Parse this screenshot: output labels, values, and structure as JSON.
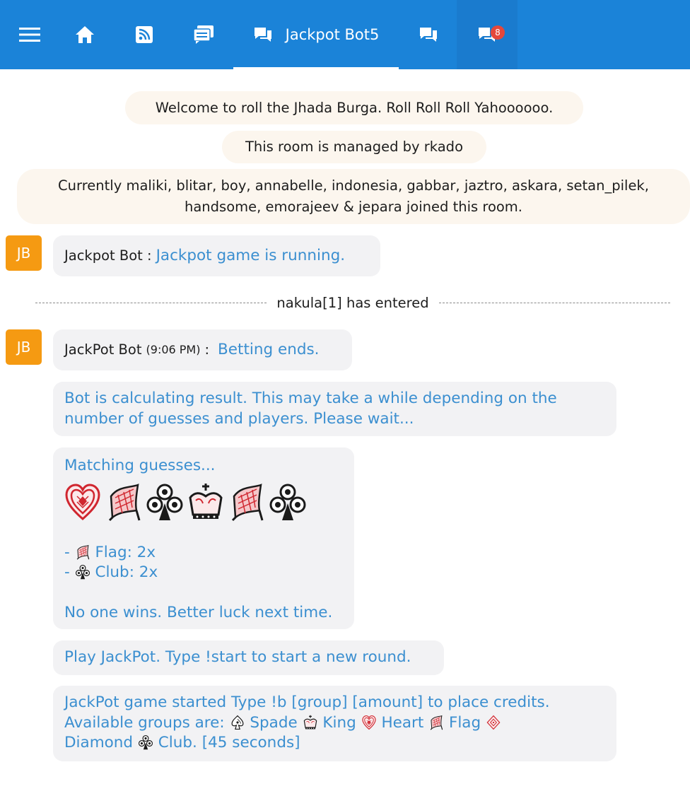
{
  "topbar": {
    "active_tab_label": "Jackpot Bot5",
    "notification_count": "8"
  },
  "notices": {
    "welcome": "Welcome to roll the Jhada Burga. Roll Roll Roll Yahoooooo.",
    "managed": "This room is managed by rkado",
    "joined": "Currently maliki, blitar, boy, annabelle, indonesia, gabbar, jaztro, askara, setan_pilek, handsome, emorajeev & jepara joined this room."
  },
  "messages": {
    "m1": {
      "avatar": "JB",
      "sender": "Jackpot Bot :",
      "text": "Jackpot game is running."
    },
    "divider": "nakula[1] has entered",
    "m2": {
      "avatar": "JB",
      "sender": "JackPot Bot",
      "time": "(9:06 PM)",
      "colon": ":",
      "text": "Betting ends."
    },
    "m3": "Bot is calculating result. This may take a while depending on the number of guesses and players. Please wait...",
    "m4": {
      "title": "Matching guesses...",
      "cards": [
        "heart-icon",
        "flag-icon",
        "club-icon",
        "king-icon",
        "flag-icon",
        "club-icon"
      ],
      "match1_prefix": "- ",
      "match1_label": "Flag: 2x",
      "match2_prefix": "- ",
      "match2_label": "Club: 2x",
      "result": "No one wins. Better luck next time."
    },
    "m5": "Play JackPot. Type !start to start a new round.",
    "m6": {
      "line1": "JackPot game started Type !b [group] [amount] to place credits.",
      "line2_prefix": "Available groups are:",
      "spade": "Spade",
      "king": "King",
      "heart": "Heart",
      "flag": "Flag",
      "diamond": "Diamond",
      "club": "Club.",
      "timer": "[45 seconds]"
    }
  },
  "colors": {
    "topbar": "#1b83d8",
    "avatar": "#f59a12",
    "bot_text": "#3b8fd0",
    "notice_bg": "#fcf6ee",
    "bubble_bg": "#f2f2f4",
    "badge": "#e4473b"
  }
}
